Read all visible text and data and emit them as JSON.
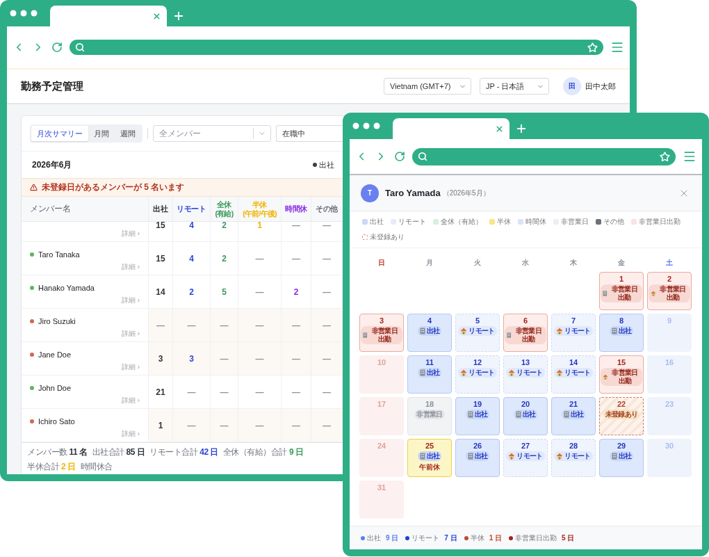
{
  "main_window": {
    "app_title": "勤務予定管理",
    "timezone": "Vietnam (GMT+7)",
    "language": "JP - 日本語",
    "user": {
      "initial": "田",
      "name": "田中太郎"
    },
    "view_tabs": [
      {
        "label": "月次サマリー",
        "selected": true
      },
      {
        "label": "月間",
        "selected": false
      },
      {
        "label": "週間",
        "selected": false
      }
    ],
    "member_filter": {
      "placeholder": "全メンバー"
    },
    "status_filter": {
      "value": "在職中"
    },
    "month": "2026年6月",
    "legend": [
      {
        "label": "出社",
        "color": "#3b3f48"
      }
    ],
    "alert": "未登録日があるメンバーが 5 名います",
    "name_header": "メンバー名",
    "columns": [
      {
        "label": "出社",
        "color": "#30343c"
      },
      {
        "label": "リモート",
        "color": "#2f46d8"
      },
      {
        "label": "全休",
        "sub": "(有給)",
        "color": "#3a9a5c"
      },
      {
        "label": "半休",
        "sub": "(午前/午後)",
        "color": "#f0b400"
      },
      {
        "label": "時間休",
        "color": "#8a2be2"
      },
      {
        "label": "その他",
        "color": "#666b75"
      }
    ],
    "rows": [
      {
        "detail": "詳細 ›",
        "missing": false,
        "cells": [
          {
            "text": "15",
            "blank": false
          },
          {
            "text": "4",
            "blank": false
          },
          {
            "text": "2",
            "blank": false
          },
          {
            "text": "1",
            "blank": false
          },
          {
            "text": "—",
            "blank": true
          },
          {
            "text": "—",
            "blank": true
          }
        ]
      },
      {
        "name": "Taro Tanaka",
        "color": "#5cb85c",
        "detail": "詳細 ›",
        "missing": false,
        "cells": [
          {
            "text": "15",
            "blank": false
          },
          {
            "text": "4",
            "blank": false
          },
          {
            "text": "2",
            "blank": false
          },
          {
            "text": "—",
            "blank": true
          },
          {
            "text": "—",
            "blank": true
          },
          {
            "text": "—",
            "blank": true
          }
        ]
      },
      {
        "name": "Hanako Yamada",
        "color": "#5cb85c",
        "detail": "詳細 ›",
        "missing": false,
        "cells": [
          {
            "text": "14",
            "blank": false
          },
          {
            "text": "2",
            "blank": false
          },
          {
            "text": "5",
            "blank": false
          },
          {
            "text": "—",
            "blank": true
          },
          {
            "text": "2",
            "blank": false
          },
          {
            "text": "—",
            "blank": true
          }
        ]
      },
      {
        "name": "Jiro Suzuki",
        "color": "#cf6a4c",
        "detail": "詳細 ›",
        "missing": true,
        "cells": [
          {
            "text": "—",
            "blank": true
          },
          {
            "text": "—",
            "blank": true
          },
          {
            "text": "—",
            "blank": true
          },
          {
            "text": "—",
            "blank": true
          },
          {
            "text": "—",
            "blank": true
          },
          {
            "text": "—",
            "blank": true
          }
        ]
      },
      {
        "name": "Jane Doe",
        "color": "#cf6a4c",
        "detail": "詳細 ›",
        "missing": true,
        "cells": [
          {
            "text": "3",
            "blank": false
          },
          {
            "text": "3",
            "blank": false
          },
          {
            "text": "—",
            "blank": true
          },
          {
            "text": "—",
            "blank": true
          },
          {
            "text": "—",
            "blank": true
          },
          {
            "text": "—",
            "blank": true
          }
        ]
      },
      {
        "name": "John Doe",
        "color": "#5cb85c",
        "detail": "詳細 ›",
        "missing": false,
        "cells": [
          {
            "text": "21",
            "blank": false
          },
          {
            "text": "—",
            "blank": true
          },
          {
            "text": "—",
            "blank": true
          },
          {
            "text": "—",
            "blank": true
          },
          {
            "text": "—",
            "blank": true
          },
          {
            "text": "—",
            "blank": true
          }
        ]
      },
      {
        "name": "Ichiro Sato",
        "color": "#cf6a4c",
        "detail": "詳細 ›",
        "missing": true,
        "cells": [
          {
            "text": "1",
            "blank": false
          },
          {
            "text": "—",
            "blank": true
          },
          {
            "text": "—",
            "blank": true
          },
          {
            "text": "—",
            "blank": true
          },
          {
            "text": "—",
            "blank": true
          },
          {
            "text": "—",
            "blank": true
          }
        ]
      }
    ],
    "totals": [
      {
        "label": "メンバー数",
        "value": "11 名",
        "color": "#30343c"
      },
      {
        "label": "出社合計",
        "value": "85 日",
        "color": "#30343c"
      },
      {
        "label": "リモート合計",
        "value": "42 日",
        "color": "#2f46d8"
      },
      {
        "label": "全休（有給）合計",
        "value": "9 日",
        "color": "#3a9a5c"
      },
      {
        "label": "半休合計",
        "value": "2 日",
        "color": "#f0b400"
      },
      {
        "label": "時間休合"
      }
    ]
  },
  "detail_window": {
    "member": {
      "initial": "T",
      "name": "Taro Yamada",
      "period": "（2026年5月）"
    },
    "legend": [
      {
        "label": "出社",
        "color": "#cad9f8",
        "dashed": false
      },
      {
        "label": "リモート",
        "color": "#e4ecfc",
        "dashed": false
      },
      {
        "label": "全休（有給）",
        "color": "#d8efdf",
        "dashed": false
      },
      {
        "label": "半休",
        "color": "#fbe38a",
        "dashed": false
      },
      {
        "label": "時間休",
        "color": "#dbe3fa",
        "dashed": false
      },
      {
        "label": "非営業日",
        "color": "#eceef1",
        "dashed": false
      },
      {
        "label": "その他",
        "color": "#6d717a",
        "dashed": false
      },
      {
        "label": "非営業日出勤",
        "color": "#fbe3df",
        "dashed": false
      },
      {
        "label": "未登録あり",
        "color": "#e0907f",
        "dashed": true
      }
    ],
    "weekdays": [
      {
        "label": "日",
        "color": "#c0392b"
      },
      {
        "label": "月",
        "color": "#8d929b"
      },
      {
        "label": "火",
        "color": "#8d929b"
      },
      {
        "label": "水",
        "color": "#8d929b"
      },
      {
        "label": "木",
        "color": "#8d929b"
      },
      {
        "label": "金",
        "color": "#8d929b"
      },
      {
        "label": "土",
        "color": "#5b7cf0"
      }
    ],
    "weeks": [
      [
        {
          "day": "1",
          "kind": "nonbiz_work",
          "badge": {
            "kind": "office",
            "label": "非営業日出勤"
          }
        },
        {
          "day": "2",
          "kind": "nonbiz_work",
          "badge": {
            "kind": "remote",
            "label": "非営業日出勤"
          }
        }
      ],
      [
        {
          "day": "3",
          "kind": "nonbiz_work",
          "badge": {
            "kind": "office",
            "label": "非営業日出勤"
          }
        },
        {
          "day": "4",
          "kind": "office",
          "badge": {
            "kind": "office",
            "label": "出社"
          }
        },
        {
          "day": "5",
          "kind": "remote",
          "badge": {
            "kind": "remote",
            "label": "リモート"
          }
        },
        {
          "day": "6",
          "kind": "nonbiz_work",
          "badge": {
            "kind": "office",
            "label": "非営業日出勤"
          }
        },
        {
          "day": "7",
          "kind": "remote",
          "badge": {
            "kind": "remote",
            "label": "リモート"
          }
        },
        {
          "day": "8",
          "kind": "office",
          "badge": {
            "kind": "office",
            "label": "出社"
          }
        },
        {
          "day": "9",
          "kind": "saturday"
        }
      ],
      [
        {
          "day": "10",
          "kind": "sunday"
        },
        {
          "day": "11",
          "kind": "office",
          "badge": {
            "kind": "office",
            "label": "出社"
          }
        },
        {
          "day": "12",
          "kind": "remote",
          "badge": {
            "kind": "remote",
            "label": "リモート"
          }
        },
        {
          "day": "13",
          "kind": "remote",
          "badge": {
            "kind": "remote",
            "label": "リモート"
          }
        },
        {
          "day": "14",
          "kind": "remote",
          "badge": {
            "kind": "remote",
            "label": "リモート"
          }
        },
        {
          "day": "15",
          "kind": "nonbiz_work",
          "badge": {
            "kind": "remote",
            "label": "非営業日出勤"
          }
        },
        {
          "day": "16",
          "kind": "saturday"
        }
      ],
      [
        {
          "day": "17",
          "kind": "sunday"
        },
        {
          "day": "18",
          "kind": "holiday",
          "badge": {
            "kind": "plain",
            "label": "非営業日"
          }
        },
        {
          "day": "19",
          "kind": "office",
          "badge": {
            "kind": "office",
            "label": "出社"
          }
        },
        {
          "day": "20",
          "kind": "office",
          "badge": {
            "kind": "office",
            "label": "出社"
          }
        },
        {
          "day": "21",
          "kind": "office",
          "badge": {
            "kind": "office",
            "label": "出社"
          }
        },
        {
          "day": "22",
          "kind": "unregistered",
          "badge": {
            "kind": "plain",
            "label": "未登録あり"
          }
        },
        {
          "day": "23",
          "kind": "saturday"
        }
      ],
      [
        {
          "day": "24",
          "kind": "sunday"
        },
        {
          "day": "25",
          "kind": "half_off",
          "badge": {
            "kind": "office",
            "label": "出社"
          },
          "note": "午前休"
        },
        {
          "day": "26",
          "kind": "office",
          "badge": {
            "kind": "office",
            "label": "出社"
          }
        },
        {
          "day": "27",
          "kind": "remote",
          "badge": {
            "kind": "remote",
            "label": "リモート"
          }
        },
        {
          "day": "28",
          "kind": "remote",
          "badge": {
            "kind": "remote",
            "label": "リモート"
          }
        },
        {
          "day": "29",
          "kind": "office",
          "badge": {
            "kind": "office",
            "label": "出社"
          }
        },
        {
          "day": "30",
          "kind": "saturday"
        }
      ],
      [
        {
          "day": "31",
          "kind": "sunday"
        }
      ]
    ],
    "summary": [
      {
        "label": "出社",
        "value": "9 日",
        "color": "#5b7cf0"
      },
      {
        "label": "リモート",
        "value": "7 日",
        "color": "#1f3fd1"
      },
      {
        "label": "半休",
        "value": "1 日",
        "color": "#c0492b"
      },
      {
        "label": "非営業日出勤",
        "value": "5 日",
        "color": "#a3261a"
      }
    ]
  }
}
